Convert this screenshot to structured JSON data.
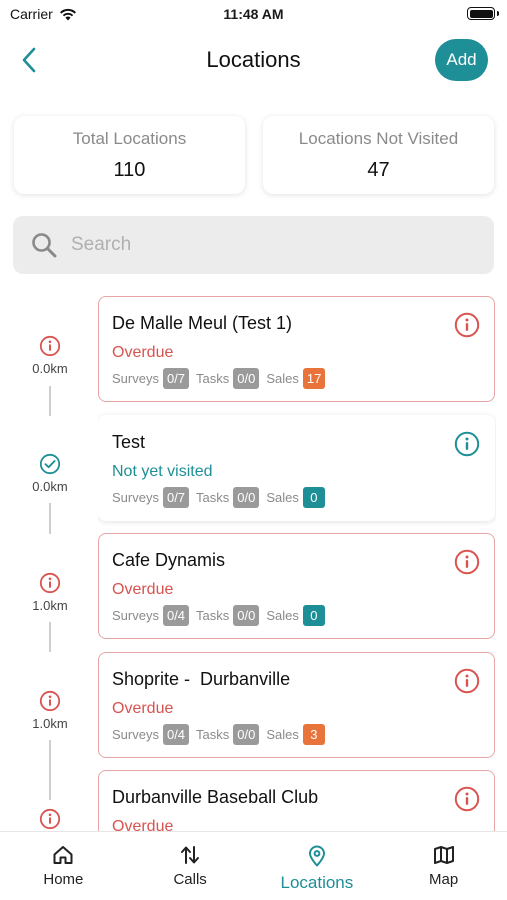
{
  "status_bar": {
    "carrier": "Carrier",
    "time": "11:48 AM"
  },
  "header": {
    "title": "Locations",
    "add_label": "Add"
  },
  "stats": {
    "total_label": "Total Locations",
    "total_value": "110",
    "not_visited_label": "Locations Not Visited",
    "not_visited_value": "47"
  },
  "search": {
    "placeholder": "Search"
  },
  "locations": [
    {
      "name": "De Malle Meul (Test 1)",
      "status": "Overdue",
      "distance": "0.0km",
      "surveys_label": "Surveys",
      "surveys": "0/7",
      "tasks_label": "Tasks",
      "tasks": "0/0",
      "sales_label": "Sales",
      "sales": "17"
    },
    {
      "name": "Test",
      "status": "Not yet visited",
      "distance": "0.0km",
      "surveys_label": "Surveys",
      "surveys": "0/7",
      "tasks_label": "Tasks",
      "tasks": "0/0",
      "sales_label": "Sales",
      "sales": "0"
    },
    {
      "name": "Cafe Dynamis",
      "status": "Overdue",
      "distance": "1.0km",
      "surveys_label": "Surveys",
      "surveys": "0/4",
      "tasks_label": "Tasks",
      "tasks": "0/0",
      "sales_label": "Sales",
      "sales": "0"
    },
    {
      "name": "Shoprite -  Durbanville",
      "status": "Overdue",
      "distance": "1.0km",
      "surveys_label": "Surveys",
      "surveys": "0/4",
      "tasks_label": "Tasks",
      "tasks": "0/0",
      "sales_label": "Sales",
      "sales": "3"
    },
    {
      "name": "Durbanville Baseball Club",
      "status": "Overdue"
    }
  ],
  "tabs": [
    {
      "label": "Home",
      "icon": "home-icon"
    },
    {
      "label": "Calls",
      "icon": "calls-icon"
    },
    {
      "label": "Locations",
      "icon": "location-pin-icon"
    },
    {
      "label": "Map",
      "icon": "map-icon"
    }
  ],
  "colors": {
    "accent": "#1e8f96",
    "overdue": "#d9534f",
    "sales_highlight": "#e8743b",
    "badge_gray": "#9a9a9a"
  }
}
